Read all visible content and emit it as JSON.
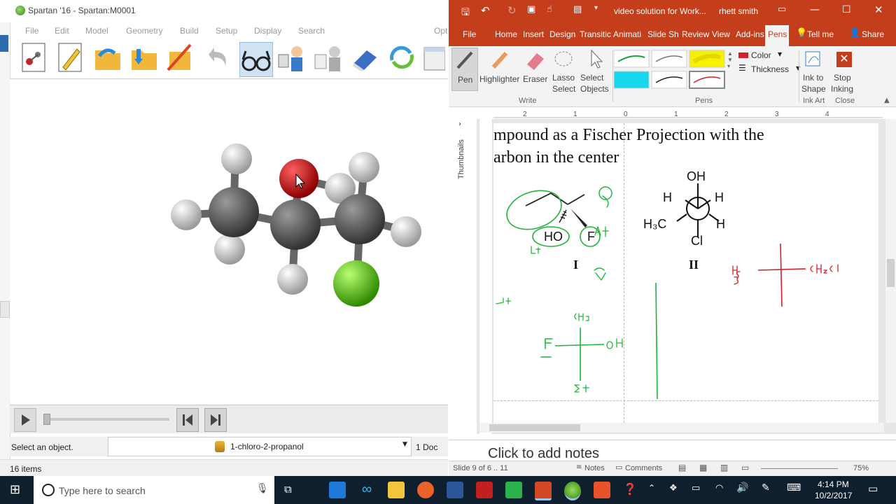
{
  "spartan": {
    "title": "Spartan '16 - Spartan:M0001",
    "menu": [
      "File",
      "Edit",
      "Model",
      "Geometry",
      "Build",
      "Setup",
      "Display",
      "Search",
      "Opt"
    ],
    "status_text": "Select an object.",
    "molecule_name": "1-chloro-2-propanol",
    "doc_count": "1 Doc",
    "items_count": "16 items"
  },
  "powerpoint": {
    "title": "video solution for Work...",
    "user": "rhett smith",
    "tabs": [
      "File",
      "Home",
      "Insert",
      "Design",
      "Transitic",
      "Animati",
      "Slide Sh",
      "Review",
      "View",
      "Add-ins",
      "Pens",
      "Tell me",
      "Share"
    ],
    "ribbon": {
      "pen": "Pen",
      "highlighter": "Highlighter",
      "eraser": "Eraser",
      "lasso": [
        "Lasso",
        "Select"
      ],
      "select_objects": [
        "Select",
        "Objects"
      ],
      "group_write": "Write",
      "group_pens": "Pens",
      "color": "Color",
      "thickness": "Thickness",
      "ink_to_shape": [
        "Ink to",
        "Shape"
      ],
      "stop_inking": [
        "Stop",
        "Inking"
      ],
      "group_ink_art": "Ink Art",
      "group_close": "Close"
    },
    "ruler_labels": [
      "2",
      "1",
      "0",
      "1",
      "2",
      "3",
      "4"
    ],
    "thumbnails_label": "Thumbnails",
    "slide": {
      "title_line1": "mpound as a Fischer Projection with the",
      "title_line2": "arbon in the center",
      "structure_I": {
        "ho": "HO",
        "f": "F",
        "label": "I"
      },
      "structure_II": {
        "oh": "OH",
        "h_left": "H",
        "h_right": "H",
        "h3c": "H₃C",
        "h_lower": "H",
        "cl": "Cl",
        "label": "II"
      }
    },
    "notes_placeholder": "Click to add notes",
    "status": {
      "slide": "Slide 9 of 6 .. 11",
      "notes": "Notes",
      "comments": "Comments",
      "zoom": "75%"
    }
  },
  "taskbar": {
    "search_placeholder": "Type here to search",
    "time": "4:14 PM",
    "date": "10/2/2017"
  },
  "colors": {
    "ppt_red": "#c43e1c",
    "ink_green": "#1fb53a",
    "ink_red": "#d4202a",
    "taskbar": "#101f2e"
  }
}
